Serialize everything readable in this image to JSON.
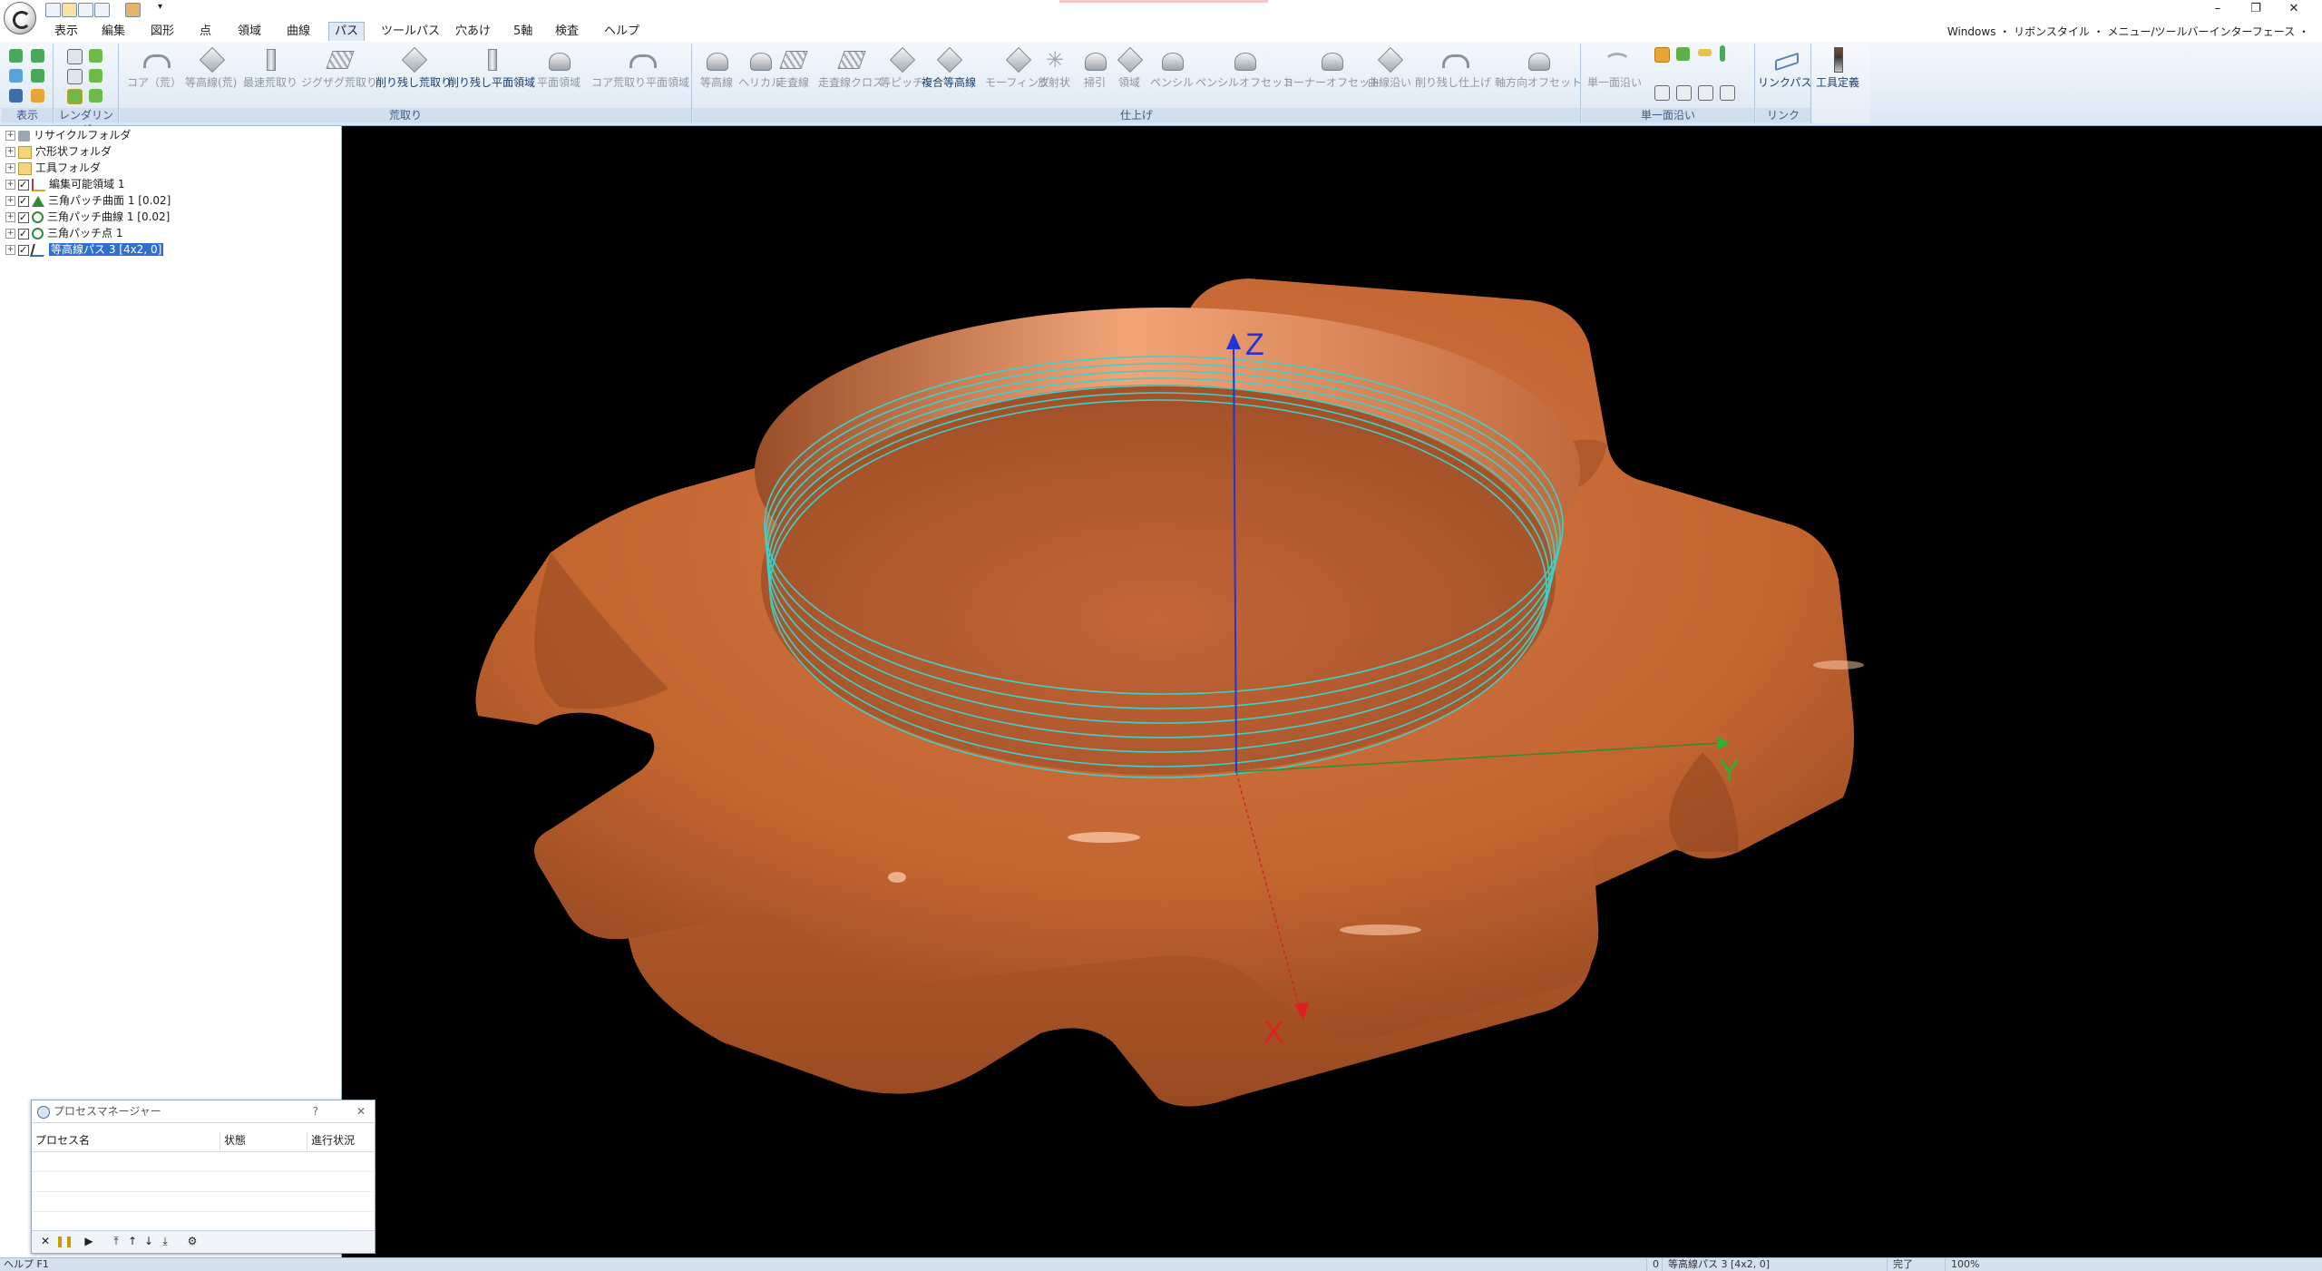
{
  "window": {
    "minimize_glyph": "–",
    "restore_glyph": "❐",
    "close_glyph": "✕",
    "qa_more_glyph": "▾"
  },
  "menu": {
    "tabs": [
      "表示",
      "編集",
      "図形",
      "点",
      "領域",
      "曲線",
      "パス",
      "ツールパス",
      "穴あけ",
      "5軸",
      "検査",
      "ヘルプ"
    ],
    "active_tab": "パス",
    "right_text": "Windows ・ リボンスタイル ・ メニュー/ツールバーインターフェース ・"
  },
  "ribbon": {
    "groups": {
      "display": "表示",
      "rendering": "レンダリング",
      "roughing": "荒取り",
      "finishing": "仕上げ",
      "single_surface": "単一面沿い",
      "link": "リンク"
    },
    "roughing_buttons": [
      {
        "label": "コア（荒）",
        "enabled": false,
        "icon": "arch-icon"
      },
      {
        "label": "等高線(荒)",
        "enabled": false,
        "icon": "diamond-icon"
      },
      {
        "label": "最速荒取り",
        "enabled": false,
        "icon": "column-icon"
      },
      {
        "label": "ジグザグ荒取り",
        "enabled": false,
        "icon": "zigzag-icon"
      },
      {
        "label": "削り残し荒取り",
        "enabled": true,
        "icon": "diamond-icon"
      },
      {
        "label": "削り残し平面領域",
        "enabled": true,
        "icon": "column-icon"
      },
      {
        "label": "平面領域",
        "enabled": false,
        "icon": "dome-icon"
      },
      {
        "label": "コア荒取り平面領域",
        "enabled": false,
        "icon": "arch-icon"
      }
    ],
    "finishing_buttons": [
      {
        "label": "等高線",
        "enabled": false,
        "icon": "dome-icon"
      },
      {
        "label": "ヘリカル",
        "enabled": false,
        "icon": "dome-icon"
      },
      {
        "label": "走査線",
        "enabled": false,
        "icon": "zigzag-icon"
      },
      {
        "label": "走査線クロス",
        "enabled": false,
        "icon": "zigzag-icon"
      },
      {
        "label": "等ピッチ",
        "enabled": false,
        "icon": "diamond-icon"
      },
      {
        "label": "複合等高線",
        "enabled": true,
        "icon": "diamond-icon"
      },
      {
        "label": "モーフィング",
        "enabled": false,
        "icon": "diamond-icon"
      },
      {
        "label": "放射状",
        "enabled": false,
        "icon": "star-icon"
      },
      {
        "label": "掃引",
        "enabled": false,
        "icon": "dome-icon"
      },
      {
        "label": "領域",
        "enabled": false,
        "icon": "diamond-icon"
      },
      {
        "label": "ペンシル",
        "enabled": false,
        "icon": "dome-icon"
      },
      {
        "label": "ペンシルオフセット",
        "enabled": false,
        "icon": "dome-icon"
      },
      {
        "label": "コーナーオフセット",
        "enabled": false,
        "icon": "dome-icon"
      },
      {
        "label": "曲線沿い",
        "enabled": false,
        "icon": "diamond-icon"
      },
      {
        "label": "削り残し仕上げ",
        "enabled": false,
        "icon": "arch-icon"
      },
      {
        "label": "軸方向オフセット",
        "enabled": false,
        "icon": "dome-icon"
      }
    ],
    "single_surface_button": "単一面沿い",
    "link_button": "リンクパス",
    "tool_button": "工具定義"
  },
  "tree": {
    "items": [
      {
        "label": "リサイクルフォルダ",
        "icon": "recycle-icon",
        "checkbox": false,
        "selected": false
      },
      {
        "label": "穴形状フォルダ",
        "icon": "folder-icon",
        "checkbox": false,
        "selected": false
      },
      {
        "label": "工具フォルダ",
        "icon": "folder-icon",
        "checkbox": false,
        "selected": false
      },
      {
        "label": "編集可能領域 1",
        "icon": "region-icon",
        "checkbox": true,
        "selected": false
      },
      {
        "label": "三角パッチ曲面 1 [0.02]",
        "icon": "triangle-icon",
        "checkbox": true,
        "selected": false
      },
      {
        "label": "三角パッチ曲線 1 [0.02]",
        "icon": "curve-icon",
        "checkbox": true,
        "selected": false
      },
      {
        "label": "三角パッチ点 1",
        "icon": "point-icon",
        "checkbox": true,
        "selected": false
      },
      {
        "label": "等高線パス 3 [4x2, 0]",
        "icon": "toolpath-icon",
        "checkbox": true,
        "selected": true
      }
    ]
  },
  "process_manager": {
    "title": "プロセスマネージャー",
    "help": "?",
    "close": "✕",
    "columns": [
      "プロセス名",
      "状態",
      "進行状況"
    ],
    "toolbar_icons": [
      "cancel-icon",
      "pause-icon",
      "play-icon",
      "move-top-icon",
      "move-up-icon",
      "move-down-icon",
      "move-bottom-icon",
      "settings-icon"
    ]
  },
  "viewport": {
    "axis_z": "Z",
    "axis_y": "Y",
    "axis_x": "X",
    "part_color": "#c8693a",
    "toolpath_color": "#3fd0c8",
    "background": "#000000"
  },
  "status": {
    "help": "ヘルプ F1",
    "count": "0",
    "object": "等高線パス 3 [4x2, 0]",
    "state": "完了",
    "zoom": "100%"
  }
}
